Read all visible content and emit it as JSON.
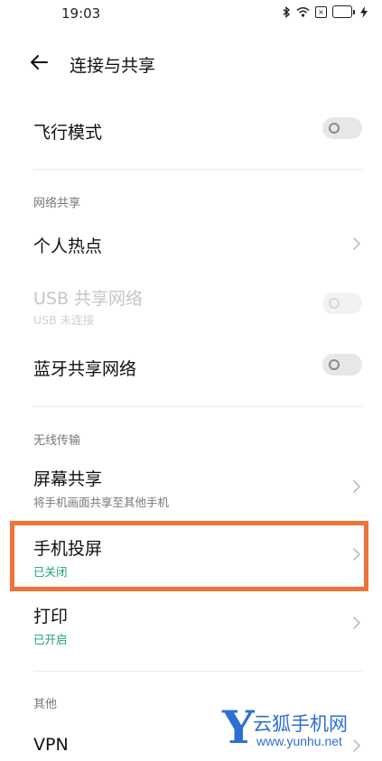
{
  "status_bar": {
    "time": "19:03",
    "icons": [
      "bluetooth-icon",
      "wifi-icon",
      "sim-icon",
      "battery-icon",
      "charging-icon"
    ],
    "battery_level": 0.75
  },
  "header": {
    "title": "连接与共享"
  },
  "airplane": {
    "title": "飞行模式",
    "enabled": false
  },
  "network_sharing": {
    "section_label": "网络共享",
    "hotspot": {
      "title": "个人热点"
    },
    "usb": {
      "title": "USB 共享网络",
      "subtitle": "USB 未连接",
      "enabled": false,
      "disabled": true
    },
    "bluetooth": {
      "title": "蓝牙共享网络",
      "enabled": false
    }
  },
  "wireless": {
    "section_label": "无线传输",
    "screen_share": {
      "title": "屏幕共享",
      "subtitle": "将手机画面共享至其他手机"
    },
    "cast": {
      "title": "手机投屏",
      "status": "已关闭"
    },
    "print": {
      "title": "打印",
      "status": "已开启"
    }
  },
  "other": {
    "section_label": "其他",
    "vpn": {
      "title": "VPN"
    }
  },
  "colors": {
    "accent_green": "#1aa36b",
    "highlight_orange": "#f0733a",
    "watermark_blue": "#2c6fd3"
  },
  "watermark": {
    "letter": "Y",
    "brand": "云狐手机网",
    "url": "www.yunhu.net"
  }
}
